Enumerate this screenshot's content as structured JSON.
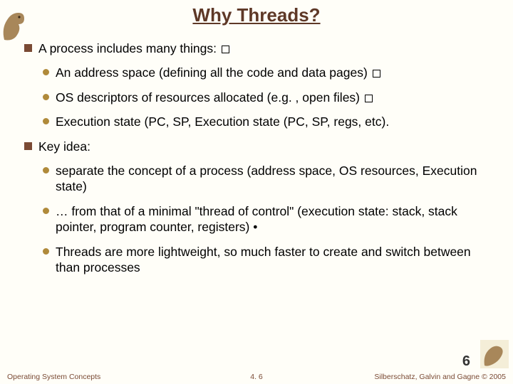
{
  "title": "Why Threads?",
  "bullets": {
    "p1": "A process includes many things: ",
    "p1a": "An address space (defining all the code and data pages) ",
    "p1b": "OS descriptors of resources allocated (e.g. , open files) ",
    "p1c": "Execution state (PC, SP, Execution state (PC, SP, regs, etc).",
    "p2": "Key idea:",
    "p2a": "separate the concept of a process (address space, OS resources, Execution state)",
    "p2b": " … from that of a minimal \"thread of control\" (execution state: stack, stack pointer, program counter, registers) •",
    "p2c": "Threads are more lightweight, so much faster to create and switch between than processes"
  },
  "page_big": "6",
  "footer": {
    "left": "Operating System Concepts",
    "center": "4. 6",
    "right": "Silberschatz, Galvin and Gagne © 2005"
  }
}
